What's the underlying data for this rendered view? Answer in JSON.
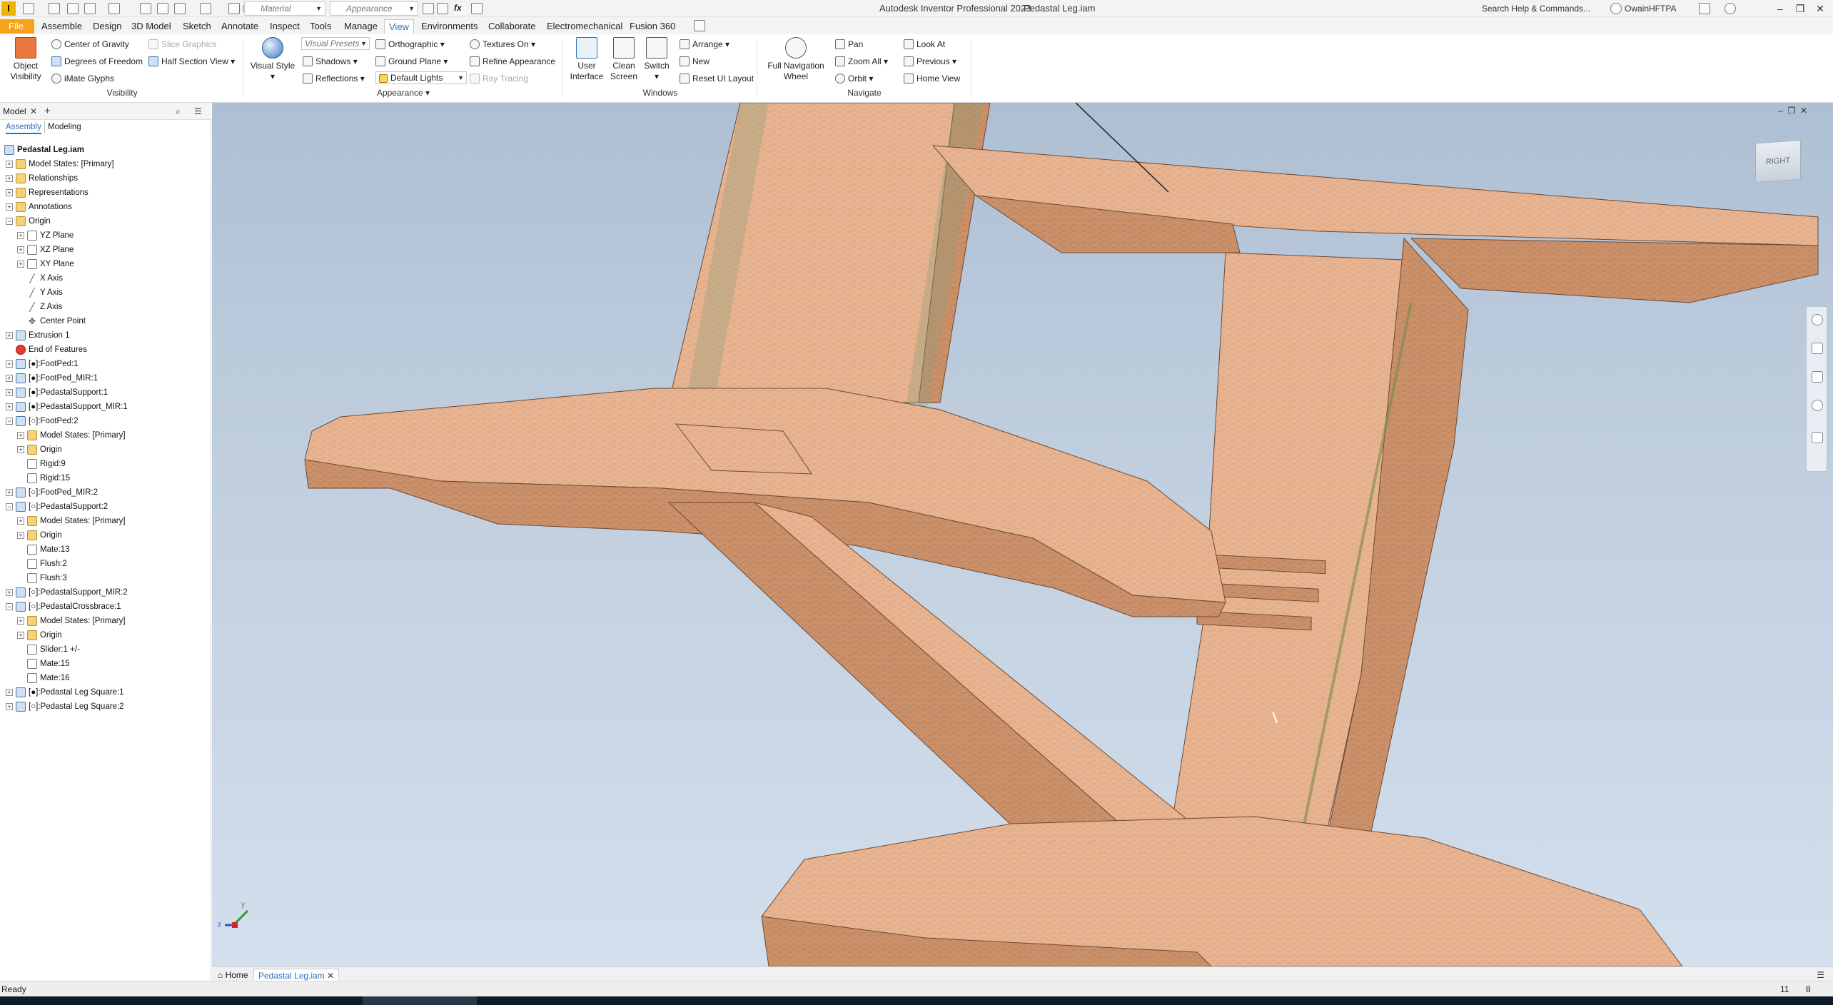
{
  "titlebar": {
    "app_logo": "I",
    "material_combo": "Material",
    "appearance_combo": "Appearance",
    "title": "Autodesk Inventor Professional 2023",
    "document": "Pedastal Leg.iam",
    "search_placeholder": "Search Help & Commands...",
    "user": "OwainHFTPA"
  },
  "menu": {
    "file": "File",
    "tabs": [
      "Assemble",
      "Design",
      "3D Model",
      "Sketch",
      "Annotate",
      "Inspect",
      "Tools",
      "Manage",
      "View",
      "Environments",
      "Collaborate",
      "Electromechanical",
      "Fusion 360"
    ],
    "active": "View"
  },
  "ribbon": {
    "visibility": {
      "object_visibility_line1": "Object",
      "object_visibility_line2": "Visibility",
      "center_of_gravity": "Center of Gravity",
      "degrees_of_freedom": "Degrees of Freedom",
      "imate_glyphs": "iMate Glyphs",
      "slice_graphics": "Slice Graphics",
      "half_section_view": "Half Section View",
      "group_label": "Visibility"
    },
    "appearance": {
      "visual_style": "Visual Style",
      "visual_presets": "Visual Presets",
      "orthographic": "Orthographic",
      "shadows": "Shadows",
      "reflections": "Reflections",
      "ground_plane": "Ground Plane",
      "default_lights": "Default Lights",
      "textures_on": "Textures On",
      "refine_appearance": "Refine Appearance",
      "ray_tracing": "Ray Tracing",
      "group_label": "Appearance"
    },
    "windows": {
      "user_interface_line1": "User",
      "user_interface_line2": "Interface",
      "clean_screen_line1": "Clean",
      "clean_screen_line2": "Screen",
      "switch": "Switch",
      "arrange": "Arrange",
      "new": "New",
      "reset_ui_layout": "Reset UI Layout",
      "group_label": "Windows"
    },
    "navigate": {
      "full_nav_line1": "Full Navigation",
      "full_nav_line2": "Wheel",
      "pan": "Pan",
      "zoom_all": "Zoom All",
      "orbit": "Orbit",
      "look_at": "Look At",
      "previous": "Previous",
      "home_view": "Home View",
      "group_label": "Navigate"
    }
  },
  "browser": {
    "tab": "Model",
    "add_tab": "+",
    "sub_assembly": "Assembly",
    "sub_modeling": "Modeling",
    "tree": [
      {
        "label": "Pedastal Leg.iam",
        "level": 0,
        "icon": "assembly",
        "bold": true
      },
      {
        "label": "Model States: [Primary]",
        "level": 1,
        "icon": "folder",
        "exp": "+"
      },
      {
        "label": "Relationships",
        "level": 1,
        "icon": "folder",
        "exp": "+"
      },
      {
        "label": "Representations",
        "level": 1,
        "icon": "folder",
        "exp": "+"
      },
      {
        "label": "Annotations",
        "level": 1,
        "icon": "folder",
        "exp": "+"
      },
      {
        "label": "Origin",
        "level": 1,
        "icon": "folder",
        "exp": "−"
      },
      {
        "label": "YZ Plane",
        "level": 2,
        "icon": "plane",
        "exp": "+"
      },
      {
        "label": "XZ Plane",
        "level": 2,
        "icon": "plane",
        "exp": "+"
      },
      {
        "label": "XY Plane",
        "level": 2,
        "icon": "plane",
        "exp": "+"
      },
      {
        "label": "X Axis",
        "level": 2,
        "icon": "axis"
      },
      {
        "label": "Y Axis",
        "level": 2,
        "icon": "axis"
      },
      {
        "label": "Z Axis",
        "level": 2,
        "icon": "axis"
      },
      {
        "label": "Center Point",
        "level": 2,
        "icon": "point"
      },
      {
        "label": "Extrusion 1",
        "level": 1,
        "icon": "part",
        "exp": "+"
      },
      {
        "label": "End of Features",
        "level": 1,
        "icon": "stop"
      },
      {
        "label": "[●]:FootPed:1",
        "level": 1,
        "icon": "part",
        "exp": "+"
      },
      {
        "label": "[●]:FootPed_MIR:1",
        "level": 1,
        "icon": "part",
        "exp": "+"
      },
      {
        "label": "[●]:PedastalSupport:1",
        "level": 1,
        "icon": "part",
        "exp": "+"
      },
      {
        "label": "[●]:PedastalSupport_MIR:1",
        "level": 1,
        "icon": "part",
        "exp": "+"
      },
      {
        "label": "[○]:FootPed:2",
        "level": 1,
        "icon": "part",
        "exp": "−"
      },
      {
        "label": "Model States: [Primary]",
        "level": 2,
        "icon": "folder",
        "exp": "+"
      },
      {
        "label": "Origin",
        "level": 2,
        "icon": "folder",
        "exp": "+"
      },
      {
        "label": "Rigid:9",
        "level": 2,
        "icon": "con"
      },
      {
        "label": "Rigid:15",
        "level": 2,
        "icon": "con"
      },
      {
        "label": "[○]:FootPed_MIR:2",
        "level": 1,
        "icon": "part",
        "exp": "+"
      },
      {
        "label": "[○]:PedastalSupport:2",
        "level": 1,
        "icon": "part",
        "exp": "−"
      },
      {
        "label": "Model States: [Primary]",
        "level": 2,
        "icon": "folder",
        "exp": "+"
      },
      {
        "label": "Origin",
        "level": 2,
        "icon": "folder",
        "exp": "+"
      },
      {
        "label": "Mate:13",
        "level": 2,
        "icon": "con"
      },
      {
        "label": "Flush:2",
        "level": 2,
        "icon": "con"
      },
      {
        "label": "Flush:3",
        "level": 2,
        "icon": "con"
      },
      {
        "label": "[○]:PedastalSupport_MIR:2",
        "level": 1,
        "icon": "part",
        "exp": "+"
      },
      {
        "label": "[○]:PedastalCrossbrace:1",
        "level": 1,
        "icon": "part",
        "exp": "−"
      },
      {
        "label": "Model States: [Primary]",
        "level": 2,
        "icon": "folder",
        "exp": "+"
      },
      {
        "label": "Origin",
        "level": 2,
        "icon": "folder",
        "exp": "+"
      },
      {
        "label": "Slider:1 +/-",
        "level": 2,
        "icon": "con"
      },
      {
        "label": "Mate:15",
        "level": 2,
        "icon": "con"
      },
      {
        "label": "Mate:16",
        "level": 2,
        "icon": "con"
      },
      {
        "label": "[●]:Pedastal Leg Square:1",
        "level": 1,
        "icon": "part",
        "exp": "+"
      },
      {
        "label": "[○]:Pedastal Leg Square:2",
        "level": 1,
        "icon": "part",
        "exp": "+"
      }
    ]
  },
  "viewport": {
    "viewcube_label": "RIGHT",
    "triad_x": "x",
    "triad_y": "y",
    "triad_z": "z"
  },
  "doc_tabs": {
    "home": "Home",
    "active_doc": "Pedastal Leg.iam"
  },
  "status": {
    "text": "Ready",
    "count1": "11",
    "count2": "8"
  },
  "colors": {
    "accent": "#f7a21b",
    "wood": "#e8b48e",
    "wood_dark": "#c9916a",
    "active_tab": "#2f6fb8"
  }
}
